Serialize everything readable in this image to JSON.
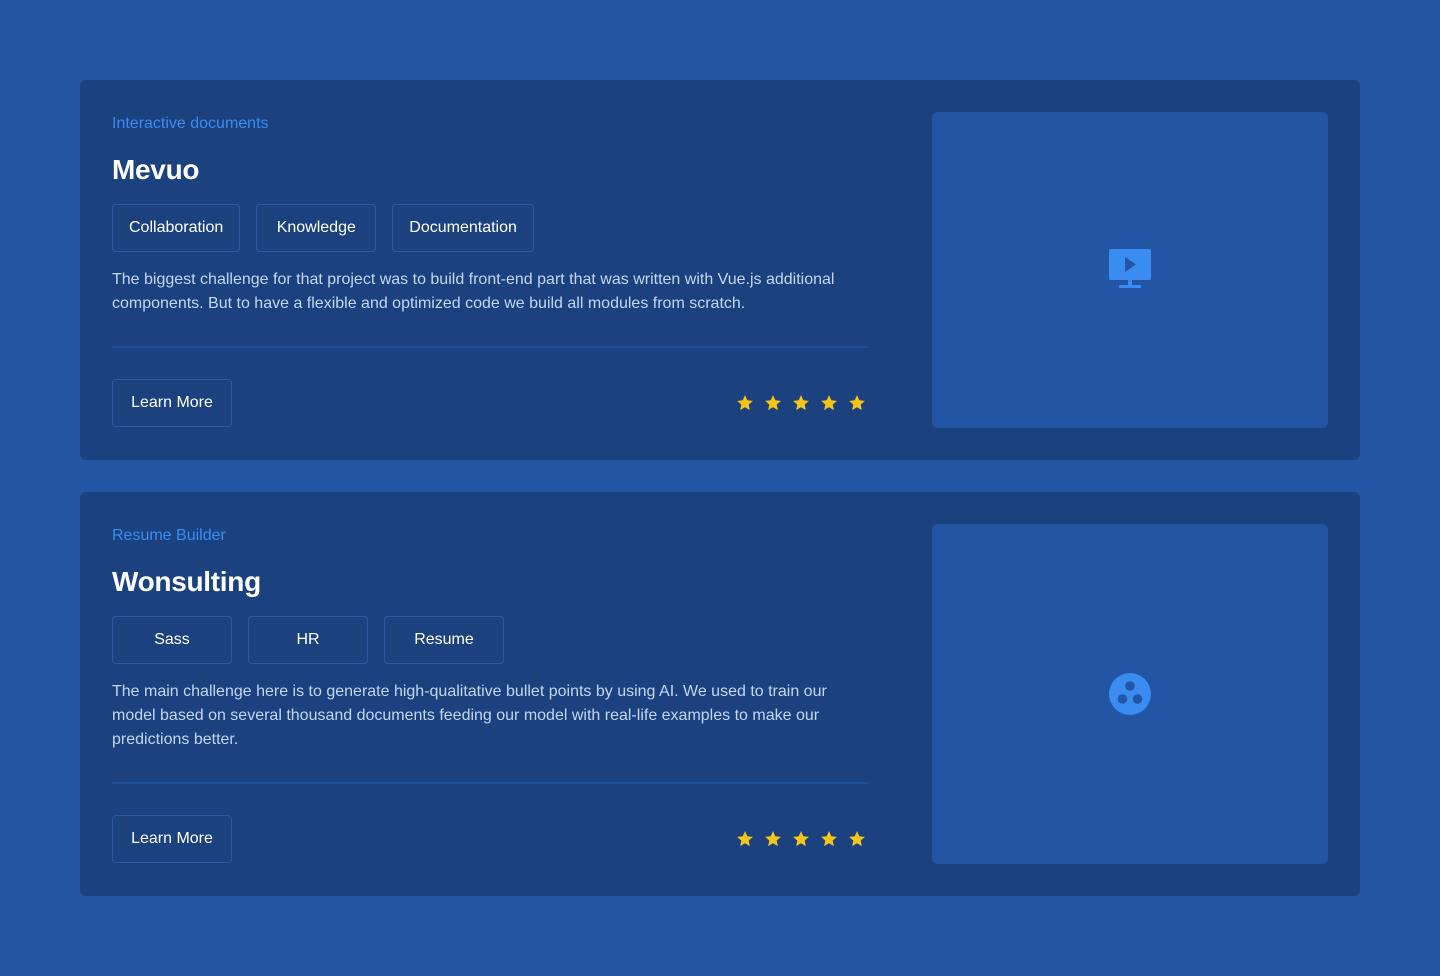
{
  "projects": [
    {
      "category": "Interactive documents",
      "title": "Mevuo",
      "tags": [
        "Collaboration",
        "Knowledge",
        "Documentation"
      ],
      "description": "The biggest challenge for that project was to build front-end part that was written with Vue.js additional components. But to have a flexible and optimized code we build all modules from scratch.",
      "button_label": "Learn More",
      "rating": 5,
      "media_icon": "monitor-play-icon"
    },
    {
      "category": "Resume Builder",
      "title": "Wonsulting",
      "tags": [
        "Sass",
        "HR",
        "Resume"
      ],
      "description": "The main challenge here is to generate high-qualitative bullet points by using AI. We used to train our model based on several thousand documents feeding our model with real-life examples to make our predictions better.",
      "button_label": "Learn More",
      "rating": 5,
      "media_icon": "three-dots-circle-icon"
    }
  ],
  "colors": {
    "background": "#2255a4",
    "card": "#1b417f",
    "accent": "#3b8cf0",
    "star": "#f5c518"
  }
}
